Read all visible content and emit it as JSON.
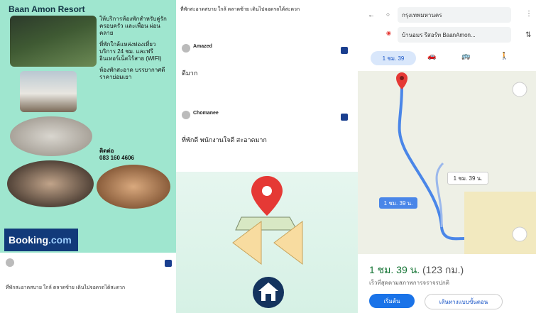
{
  "left": {
    "title": "Baan Amon Resort",
    "description": [
      "ให้บริการห้องพักสำหรับคู่รัก ครอบครัว และเพื่อน ผ่อนคลาย",
      "ที่พักใกล้แหล่งท่องเที่ยว บริการ 24 ชม. และฟรีอินเทอร์เน็ตไร้สาย (WIFI)",
      "ห้องพักสะอาด บรรยากาศดี ราคาย่อมเยา"
    ],
    "contact_label": "ติดต่อ",
    "contact_phone": "083 160 4606",
    "booking_brand": "Booking",
    "booking_suffix": ".com"
  },
  "middle": {
    "top_text": "ที่พักสะอาดสบาย ใกล้ ตลาดซ้าย เดินไปจอดรถได้สะดวก",
    "review1_name": "Amazed",
    "review1_body": "ดีมาก",
    "review2_name": "Chomanee",
    "review2_body": "ที่พักดี พนักงานใจดี สะอาดมาก"
  },
  "right": {
    "from": "กรุงเทพมหานคร",
    "to": "บ้านอมร รีสอร์ท BaanAmon...",
    "mode_time": "1 ชม. 39",
    "route_label": "1 ชม. 39 น.",
    "alt_route": "1 ชม. 39 น.",
    "duration": "1 ชม. 39 น.",
    "distance": "(123 กม.)",
    "subtitle": "เร็วที่สุดตามสภาพการจราจรปกติ",
    "start_button": "เริ่มต้น",
    "steps_button": "เส้นทางแบบขั้นตอน"
  },
  "colors": {
    "booking_blue": "#123a7a",
    "route_blue": "#4a86e8",
    "pin_red": "#e53935",
    "arrow_yellow": "#f8dca0",
    "home_navy": "#14335e"
  }
}
